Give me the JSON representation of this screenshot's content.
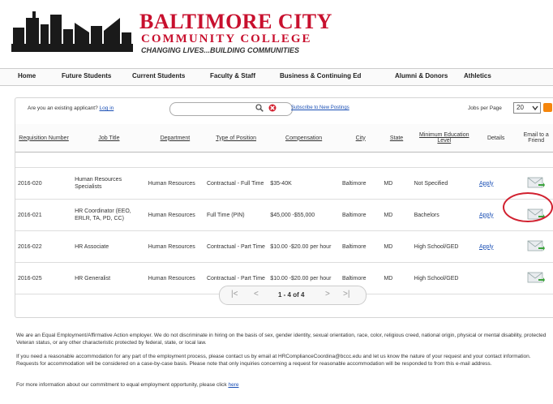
{
  "brand": {
    "line1": "BALTIMORE CITY",
    "line2": "COMMUNITY COLLEGE",
    "line3": "CHANGING LIVES...BUILDING COMMUNITIES",
    "color": "#c8102e"
  },
  "nav": [
    "Home",
    "Future Students",
    "Current Students",
    "Faculty & Staff",
    "Business & Continuing Ed",
    "Alumni & Donors",
    "Athletics"
  ],
  "toolbar": {
    "existing_prefix": "Are you an existing applicant?",
    "login_label": "Log in",
    "search_value": "",
    "subscribe_label": "Subscribe to New Postings",
    "jobs_per_page_label": "Jobs per Page",
    "jobs_per_page_value": "20"
  },
  "table": {
    "headers": [
      "Requisition Number",
      "Job Title",
      "Department",
      "Type of Position",
      "Compensation",
      "City",
      "State",
      "Minimum Education Level",
      "Details",
      "Email to a Friend"
    ],
    "rows": [
      {
        "req": "2016-020",
        "title": "Human Resources Specialists",
        "dept": "Human Resources",
        "type": "Contractual - Full Time",
        "comp": "$35-40K",
        "city": "Baltimore",
        "state": "MD",
        "edu": "Not Specified",
        "apply": "Apply"
      },
      {
        "req": "2016-021",
        "title": "HR Coordinator (EEO, ERLR, TA, PD, CC)",
        "dept": "Human Resources",
        "type": "Full Time (PIN)",
        "comp": "$45,000 -$55,000",
        "city": "Baltimore",
        "state": "MD",
        "edu": "Bachelors",
        "apply": "Apply"
      },
      {
        "req": "2016-022",
        "title": "HR Associate",
        "dept": "Human Resources",
        "type": "Contractual - Part Time",
        "comp": "$10.00 -$20.00 per hour",
        "city": "Baltimore",
        "state": "MD",
        "edu": "High School/GED",
        "apply": "Apply"
      },
      {
        "req": "2016-025",
        "title": "HR Generalist",
        "dept": "Human Resources",
        "type": "Contractual - Part Time",
        "comp": "$10.00 -$20.00 per hour",
        "city": "Baltimore",
        "state": "MD",
        "edu": "High School/GED",
        "apply": ""
      }
    ]
  },
  "pager": {
    "first": "|<",
    "prev": "<",
    "text": "1 - 4 of 4",
    "next": ">",
    "last": ">|"
  },
  "footer": {
    "eeo": "We are an Equal Employment/Affirmative Action employer. We do not discriminate in hiring on the basis of sex, gender identity, sexual orientation, race, color, religious creed, national origin, physical or mental disability, protected Veteran status, or any other characteristic protected by federal, state, or local law.",
    "accommodation": "If you need a reasonable accommodation for any part of the employment process, please contact us by email at HRComplianceCoordina@bccc.edu and let us know the nature of your request and your contact information. Requests for accommodation will be considered on a case-by-case basis. Please note that only inquiries concerning a request for reasonable accommodation will be responded to from this e-mail address.",
    "more_info": "For more information about our commitment to equal employment opportunity, please click",
    "here_label": "here"
  }
}
